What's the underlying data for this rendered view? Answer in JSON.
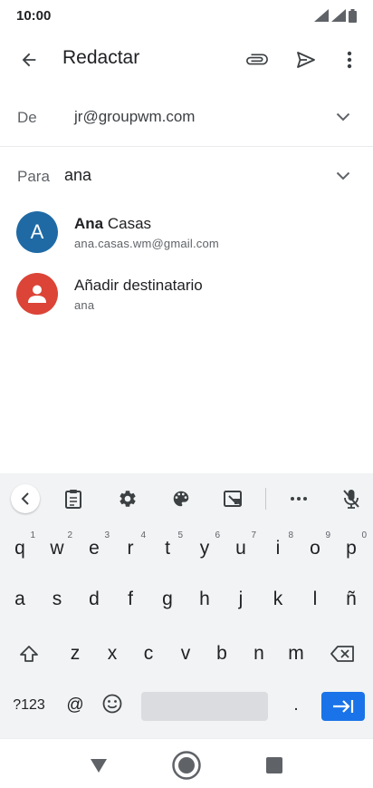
{
  "status_bar": {
    "time": "10:00"
  },
  "app_bar": {
    "title": "Redactar",
    "icons": [
      "back-arrow-icon",
      "paperclip-icon",
      "send-icon",
      "more-vert-icon"
    ]
  },
  "compose": {
    "from_label": "De",
    "from_value": "jr@groupwm.com",
    "to_label": "Para",
    "to_value": "ana"
  },
  "suggestions": [
    {
      "avatar_letter": "A",
      "name_bold": "Ana",
      "name_rest": " Casas",
      "email": "ana.casas.wm@gmail.com",
      "avatar_color": "#1f6aa5"
    },
    {
      "avatar_letter": "",
      "name_bold": "",
      "name_rest": "Añadir destinatario",
      "email": "ana",
      "avatar_color": "#db4437"
    }
  ],
  "keyboard": {
    "row1": [
      {
        "k": "q",
        "h": "1"
      },
      {
        "k": "w",
        "h": "2"
      },
      {
        "k": "e",
        "h": "3"
      },
      {
        "k": "r",
        "h": "4"
      },
      {
        "k": "t",
        "h": "5"
      },
      {
        "k": "y",
        "h": "6"
      },
      {
        "k": "u",
        "h": "7"
      },
      {
        "k": "i",
        "h": "8"
      },
      {
        "k": "o",
        "h": "9"
      },
      {
        "k": "p",
        "h": "0"
      }
    ],
    "row2": [
      "a",
      "s",
      "d",
      "f",
      "g",
      "h",
      "j",
      "k",
      "l",
      "ñ"
    ],
    "row3": [
      "z",
      "x",
      "c",
      "v",
      "b",
      "n",
      "m"
    ],
    "symbols_key": "?123",
    "at_key": "@",
    "period_key": "."
  },
  "colors": {
    "accent": "#1a73e8",
    "keyboard_bg": "#f1f3f4"
  }
}
